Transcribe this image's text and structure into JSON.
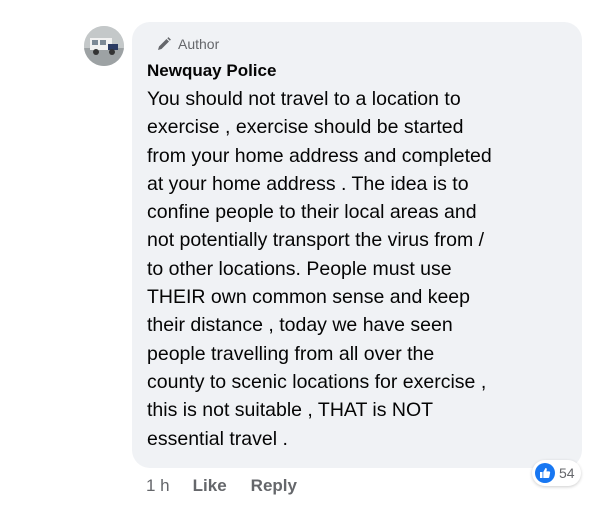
{
  "comment": {
    "author_badge": "Author",
    "name": "Newquay Police",
    "text_lines": [
      "You should not travel to a location to",
      "exercise , exercise should be started",
      "from your home address and completed",
      "at your home address . The idea is to",
      "confine people to their local areas and",
      "not potentially transport the virus from /",
      "to other locations. People must use",
      "THEIR own common sense and keep",
      "their distance , today we have seen",
      "people travelling from all over the",
      "county to scenic locations for exercise ,",
      "this is not suitable , THAT is NOT",
      "essential travel ."
    ]
  },
  "actions": {
    "timestamp": "1 h",
    "like_label": "Like",
    "reply_label": "Reply"
  },
  "reactions": {
    "icon": "thumbs-up-icon",
    "count": "54"
  },
  "colors": {
    "bubble_bg": "#f0f2f5",
    "like_blue": "#1877f2",
    "secondary_text": "#65676b"
  }
}
